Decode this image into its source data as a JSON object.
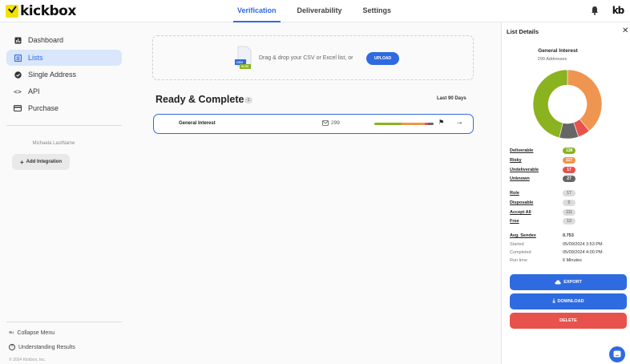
{
  "app": {
    "logo_text": "kickbox",
    "avatar_text": "kb"
  },
  "nav": {
    "tabs": [
      {
        "label": "Verification",
        "active": true
      },
      {
        "label": "Deliverability",
        "active": false
      },
      {
        "label": "Settings",
        "active": false
      }
    ]
  },
  "sidebar": {
    "items": [
      {
        "label": "Dashboard",
        "icon": "dashboard-icon",
        "active": false
      },
      {
        "label": "Lists",
        "icon": "list-icon",
        "active": true
      },
      {
        "label": "Single Address",
        "icon": "check-circle-icon",
        "active": false
      },
      {
        "label": "API",
        "icon": "code-icon",
        "active": false
      },
      {
        "label": "Purchase",
        "icon": "credit-card-icon",
        "active": false
      }
    ],
    "user_name": "Michaela LastName",
    "add_integration": "Add Integration",
    "collapse_menu": "Collapse Menu",
    "understanding_results": "Understanding Results",
    "copyright": "© 2024 Kickbox, Inc."
  },
  "upload": {
    "file_types": [
      "CSV",
      "XLSX"
    ],
    "text": "Drag & drop your CSV or Excel list, or",
    "button": "UPLOAD"
  },
  "lists": {
    "title": "Ready & Complete",
    "count": "1",
    "range": "Last 90 Days",
    "rows": [
      {
        "name": "General Interest",
        "count": "299"
      }
    ]
  },
  "details": {
    "title": "List Details",
    "list_name": "General Interest",
    "addresses": "299 Addresses",
    "results": [
      {
        "label": "Deliverable",
        "value": "138",
        "color": "#8ab31f"
      },
      {
        "label": "Risky",
        "value": "117",
        "color": "#f0954f"
      },
      {
        "label": "Undeliverable",
        "value": "17",
        "color": "#e8524d"
      },
      {
        "label": "Unknown",
        "value": "27",
        "color": "#666666"
      }
    ],
    "flags": [
      {
        "label": "Role",
        "value": "17"
      },
      {
        "label": "Disposable",
        "value": "0"
      },
      {
        "label": "Accept All",
        "value": "111"
      },
      {
        "label": "Free",
        "value": "13"
      }
    ],
    "sendex_label": "Avg. Sendex",
    "sendex_value": "0.753",
    "meta": [
      {
        "label": "Started",
        "value": "05/09/2024 3:53 PM"
      },
      {
        "label": "Completed",
        "value": "05/09/2024 4:00 PM"
      },
      {
        "label": "Run time",
        "value": "6 Minutes"
      }
    ],
    "buttons": {
      "export": "EXPORT",
      "download": "DOWNLOAD",
      "delete": "DELETE"
    }
  },
  "colors": {
    "accent": "#2f6be0",
    "delete": "#e8524d",
    "deliverable": "#8ab31f",
    "risky": "#f0954f",
    "undeliverable": "#e8524d",
    "unknown": "#666666"
  }
}
